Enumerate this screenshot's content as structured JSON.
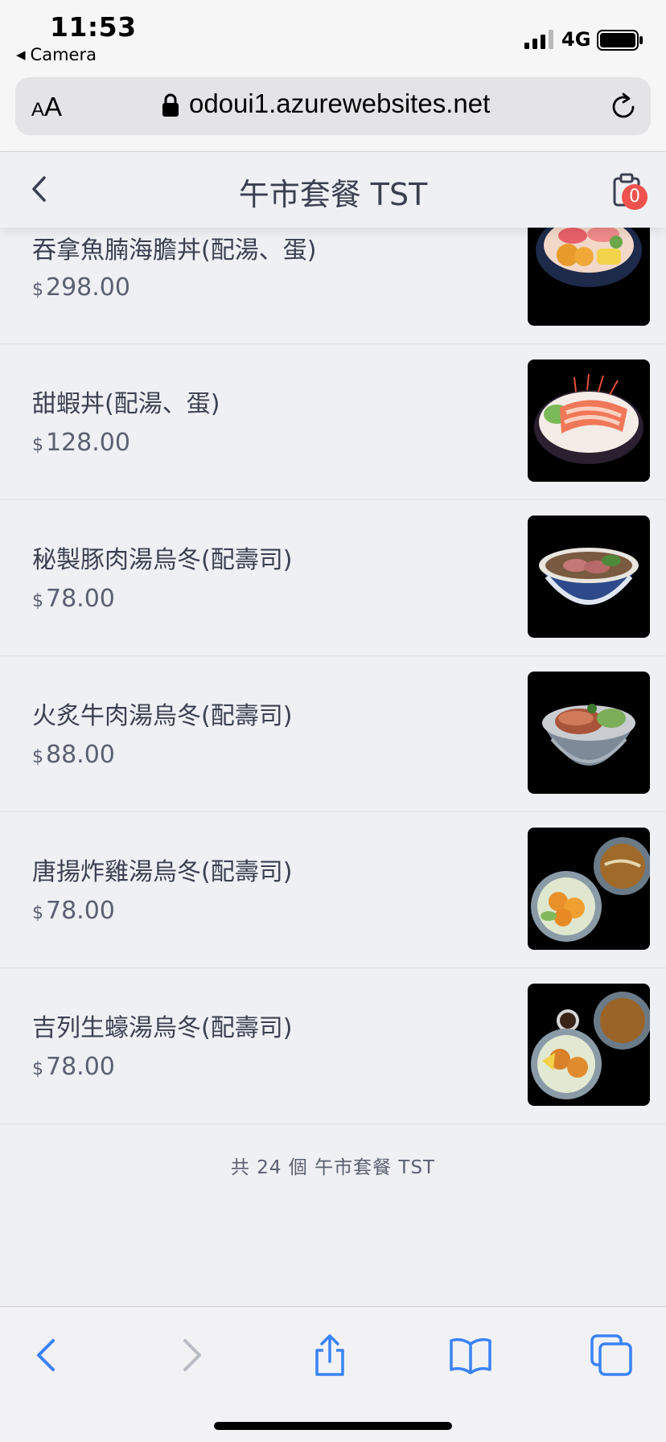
{
  "status_bar": {
    "time": "11:53",
    "back_label": "Camera",
    "network": "4G"
  },
  "browser": {
    "text_size_small": "A",
    "text_size_big": "A",
    "url": "odoui1.azurewebsites.net"
  },
  "header": {
    "title": "午市套餐 TST",
    "cart_count": "0"
  },
  "items": [
    {
      "name": "吞拿魚腩海膽丼(配湯、蛋)",
      "currency": "$",
      "price": "298.00"
    },
    {
      "name": "甜蝦丼(配湯、蛋)",
      "currency": "$",
      "price": "128.00"
    },
    {
      "name": "秘製豚肉湯烏冬(配壽司)",
      "currency": "$",
      "price": "78.00"
    },
    {
      "name": "火炙牛肉湯烏冬(配壽司)",
      "currency": "$",
      "price": "88.00"
    },
    {
      "name": "唐揚炸雞湯烏冬(配壽司)",
      "currency": "$",
      "price": "78.00"
    },
    {
      "name": "吉列生蠔湯烏冬(配壽司)",
      "currency": "$",
      "price": "78.00"
    }
  ],
  "footer": {
    "summary": "共 24 個 午市套餐 TST"
  },
  "colors": {
    "accent": "#3a82f7",
    "badge": "#f0524d",
    "background": "#eef0f4"
  }
}
